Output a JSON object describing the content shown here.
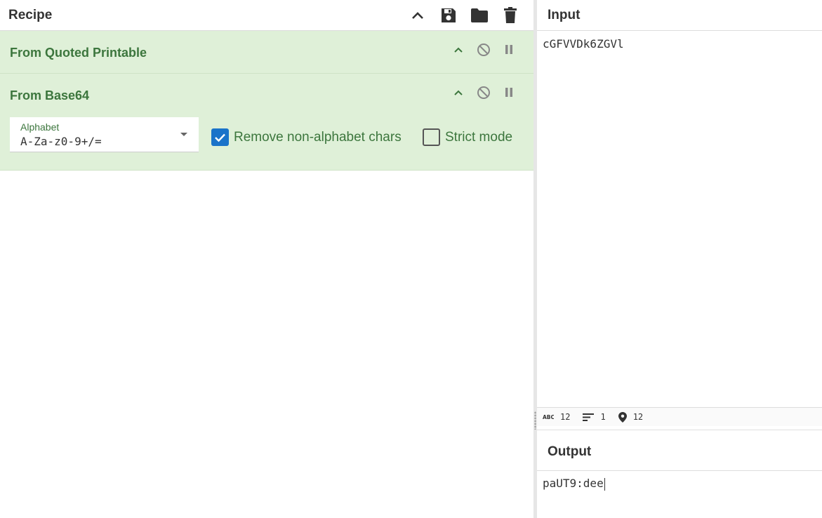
{
  "recipe": {
    "title": "Recipe",
    "tools": [
      {
        "name": "chevron-up-icon"
      },
      {
        "name": "save-icon"
      },
      {
        "name": "folder-icon"
      },
      {
        "name": "trash-icon"
      }
    ],
    "operations": [
      {
        "title": "From Quoted Printable"
      },
      {
        "title": "From Base64",
        "alphabet_label": "Alphabet",
        "alphabet_value": "A-Za-z0-9+/=",
        "remove_nonalpha_label": "Remove non-alphabet chars",
        "remove_nonalpha_checked": true,
        "strict_mode_label": "Strict mode",
        "strict_mode_checked": false
      }
    ]
  },
  "input": {
    "title": "Input",
    "value": "cGFVVDk6ZGVl",
    "stats": {
      "length": "12",
      "lines": "1",
      "position": "12"
    }
  },
  "output": {
    "title": "Output",
    "value": "paUT9:dee"
  },
  "colors": {
    "op_background": "#dff0d8",
    "op_text": "#3c763d",
    "checkbox_checked": "#1a73c9"
  }
}
